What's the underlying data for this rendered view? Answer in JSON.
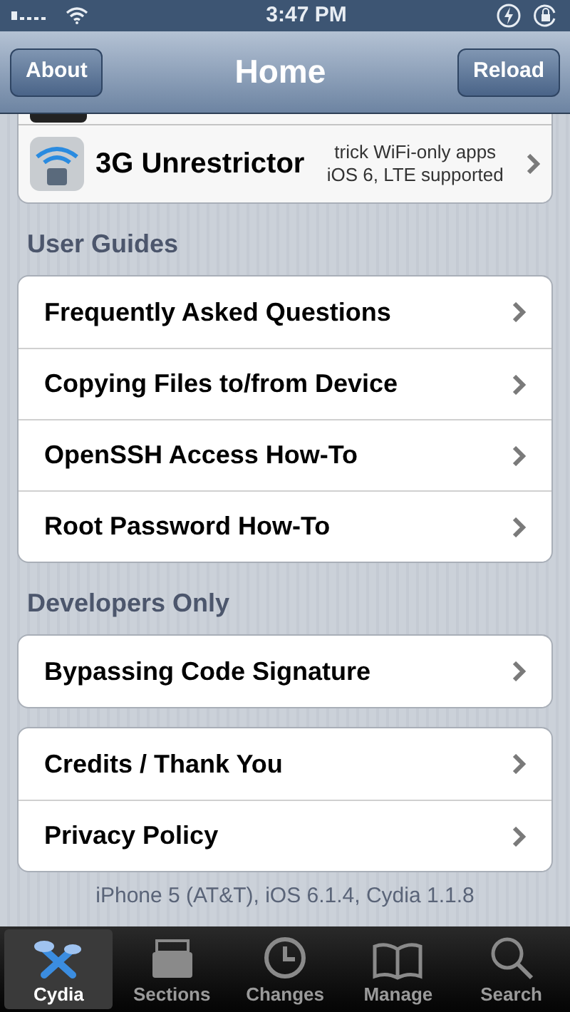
{
  "status_bar": {
    "time": "3:47 PM"
  },
  "nav_bar": {
    "title": "Home",
    "left_button": "About",
    "right_button": "Reload"
  },
  "featured": {
    "title": "3G Unrestrictor",
    "subtitle_lines": [
      "trick WiFi-only apps",
      "iOS 6, LTE supported"
    ]
  },
  "sections": [
    {
      "header": "User Guides",
      "groups": [
        [
          "Frequently Asked Questions",
          "Copying Files to/from Device",
          "OpenSSH Access How-To",
          "Root Password How-To"
        ]
      ]
    },
    {
      "header": "Developers Only",
      "groups": [
        [
          "Bypassing Code Signature"
        ],
        [
          "Credits / Thank You",
          "Privacy Policy"
        ]
      ]
    }
  ],
  "footer": "iPhone 5 (AT&T), iOS 6.1.4, Cydia 1.1.8",
  "tab_bar": [
    {
      "label": "Cydia",
      "kind": "cydia",
      "selected": true
    },
    {
      "label": "Sections",
      "kind": "sections",
      "selected": false
    },
    {
      "label": "Changes",
      "kind": "changes",
      "selected": false
    },
    {
      "label": "Manage",
      "kind": "manage",
      "selected": false
    },
    {
      "label": "Search",
      "kind": "search",
      "selected": false
    }
  ]
}
